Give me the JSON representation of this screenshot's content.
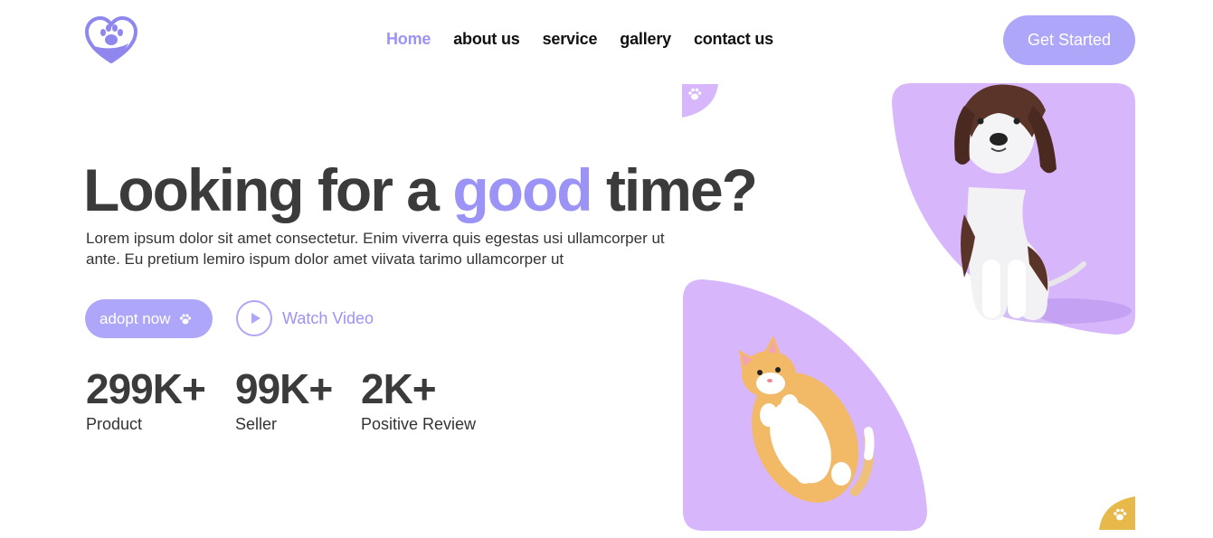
{
  "header": {
    "logo_icon": "heart-paw-logo",
    "nav": [
      {
        "label": "Home",
        "active": true
      },
      {
        "label": "about us",
        "active": false
      },
      {
        "label": "service",
        "active": false
      },
      {
        "label": "gallery",
        "active": false
      },
      {
        "label": "contact us",
        "active": false
      }
    ],
    "cta_label": "Get Started"
  },
  "hero": {
    "title_before": "Looking for a",
    "title_accent": "good",
    "title_after": "time?",
    "description": "Lorem ipsum dolor sit amet consectetur. Enim viverra quis egestas usi ullamcorper ut ante. Eu pretium lemiro ispum dolor amet viivata tarimo ullamcorper ut",
    "adopt_label": "adopt now",
    "watch_label": "Watch Video"
  },
  "stats": [
    {
      "value": "299K+",
      "label": "Product"
    },
    {
      "value": "99K+",
      "label": "Seller"
    },
    {
      "value": "2K+",
      "label": "Positive Review"
    }
  ],
  "images": {
    "dog": "beagle-dog-3d-figure",
    "cat": "orange-cat-3d-figure"
  },
  "colors": {
    "accent": "#9b93f5",
    "button": "#aea6f8",
    "card_purple": "#d8b6fb",
    "yellow": "#e7b94b"
  }
}
